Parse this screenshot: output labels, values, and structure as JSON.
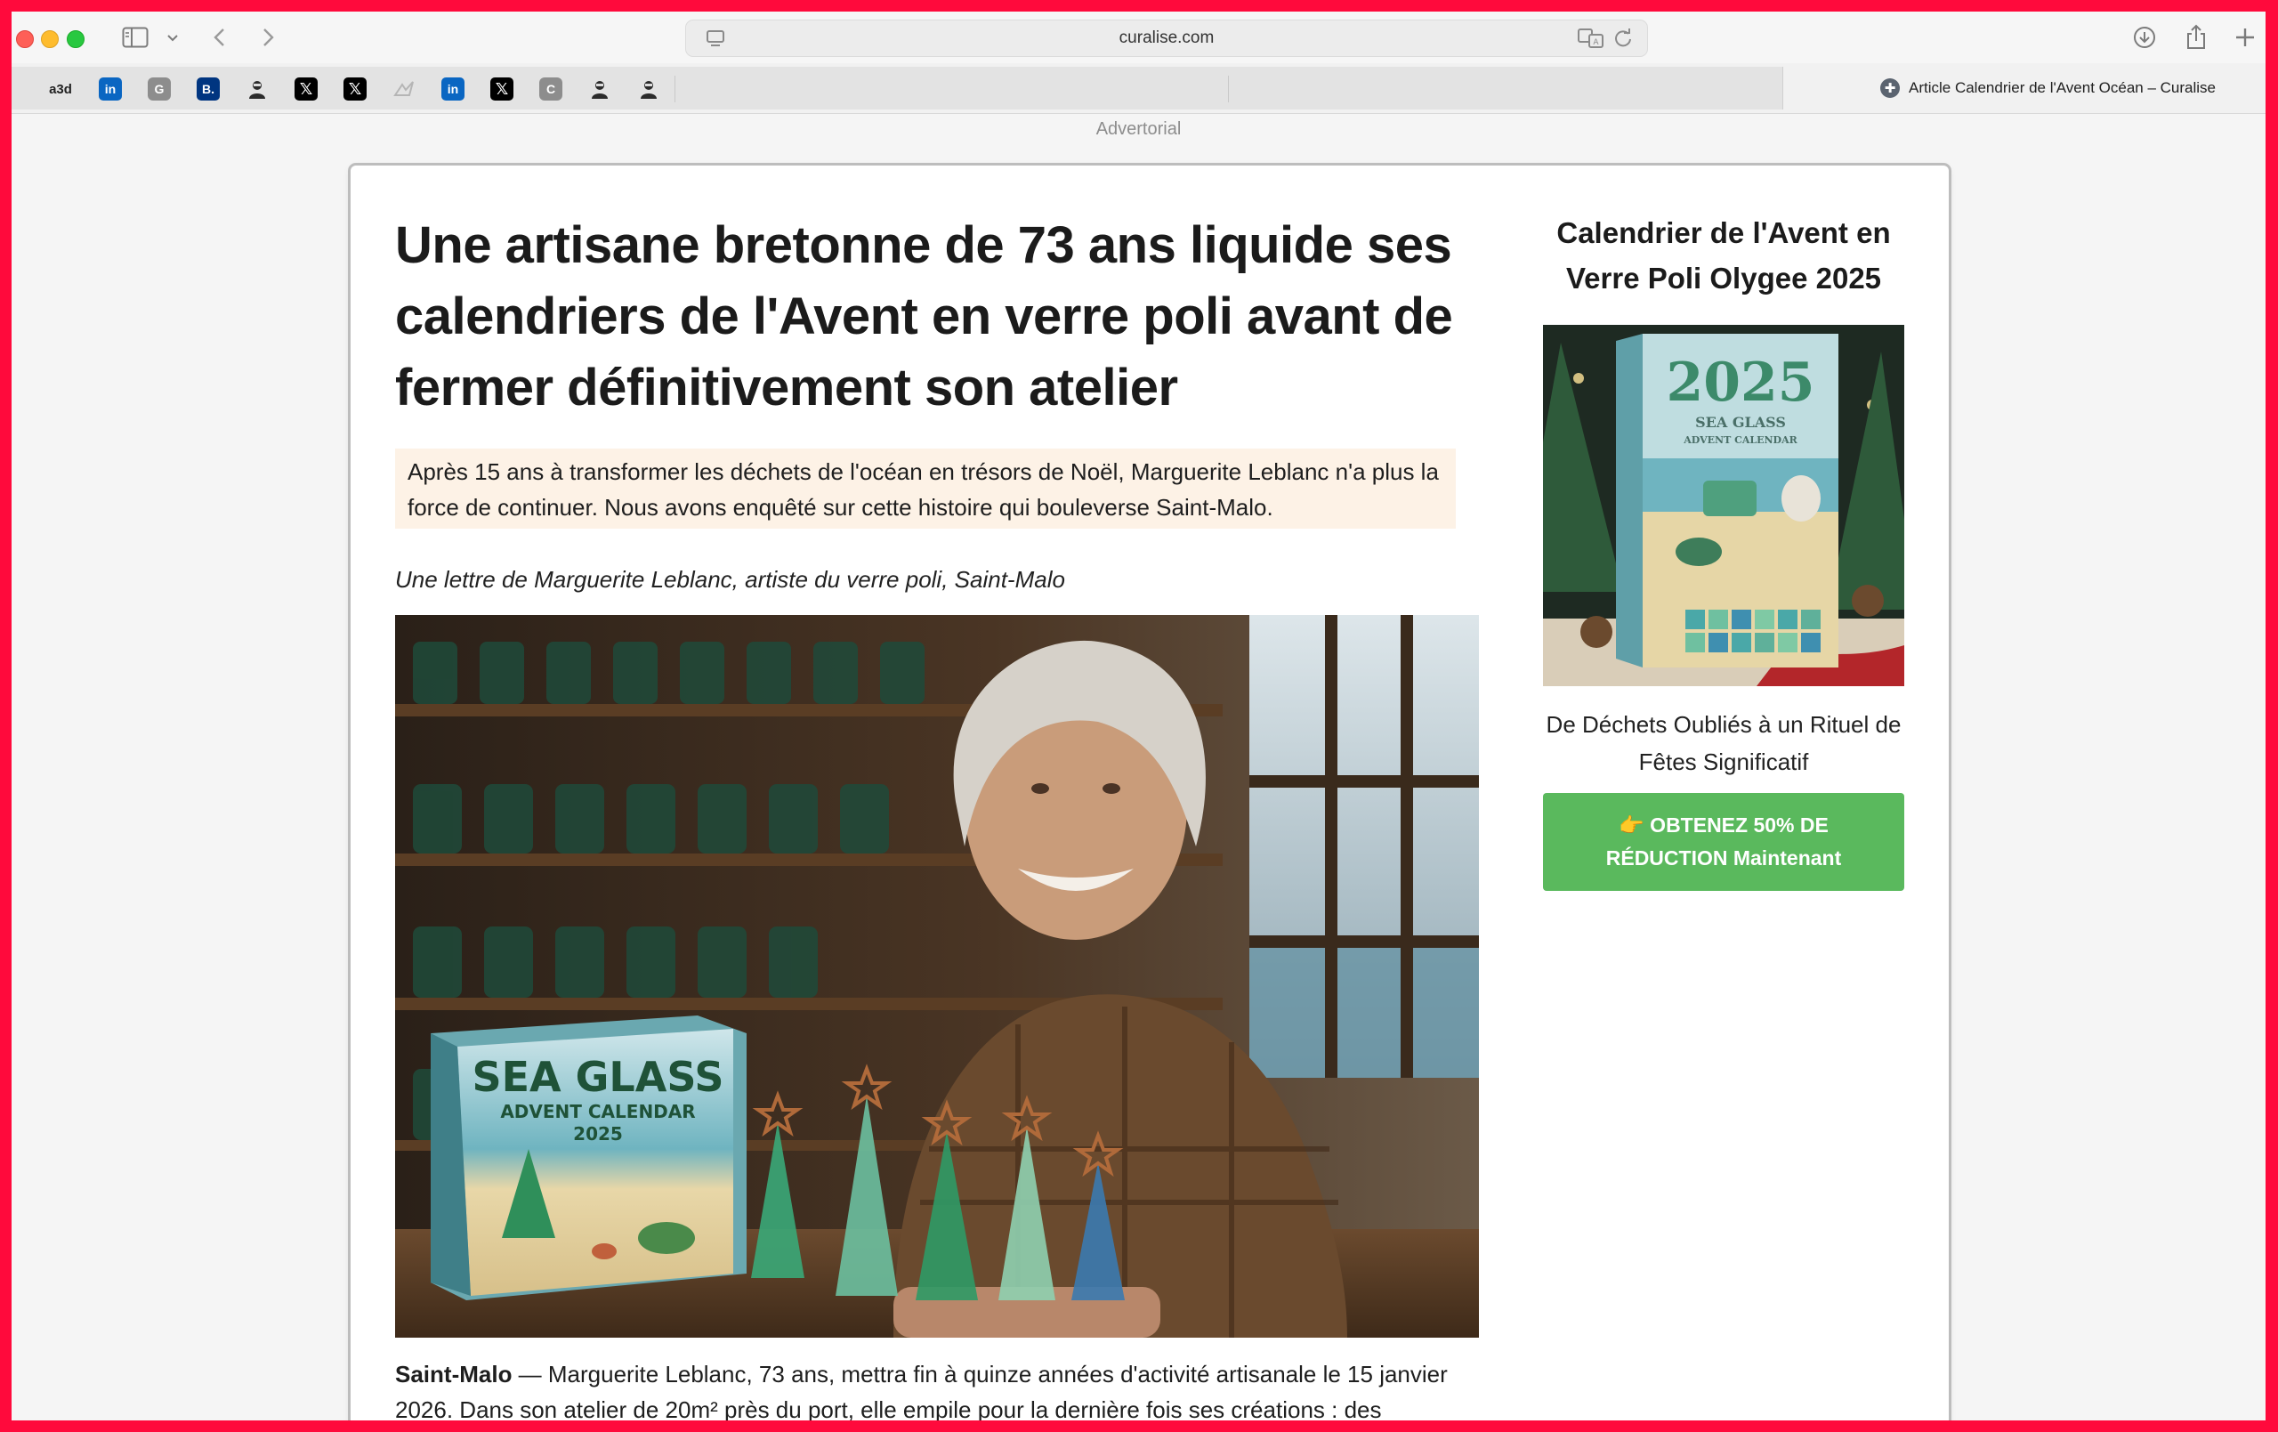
{
  "browser": {
    "url": "curalise.com",
    "active_tab_title": "Article Calendrier de l'Avent Océan – Curalise",
    "favorites": [
      {
        "icon": "partial-icon",
        "label": "",
        "kind": "edge"
      },
      {
        "icon": "a3d-icon",
        "label": "a3d",
        "kind": "a3"
      },
      {
        "icon": "linkedin-icon",
        "label": "in",
        "kind": "li"
      },
      {
        "icon": "g-icon",
        "label": "G",
        "kind": "g"
      },
      {
        "icon": "booking-icon",
        "label": "B.",
        "kind": "b"
      },
      {
        "icon": "person-icon",
        "label": "",
        "kind": "p"
      },
      {
        "icon": "x-icon",
        "label": "𝕏",
        "kind": "x"
      },
      {
        "icon": "x-icon",
        "label": "𝕏",
        "kind": "x"
      },
      {
        "icon": "bird-icon",
        "label": "",
        "kind": "bird"
      },
      {
        "icon": "linkedin-icon",
        "label": "in",
        "kind": "li"
      },
      {
        "icon": "x-icon",
        "label": "𝕏",
        "kind": "x"
      },
      {
        "icon": "c-icon",
        "label": "C",
        "kind": "g"
      },
      {
        "icon": "person-icon",
        "label": "",
        "kind": "p"
      },
      {
        "icon": "person-icon",
        "label": "",
        "kind": "p"
      }
    ]
  },
  "page": {
    "advertorial_label": "Advertorial",
    "headline": "Une artisane bretonne de 73 ans liquide ses calendriers de l'Avent en verre poli avant de fermer définitivement son atelier",
    "lede": "Après 15 ans à transformer les déchets de l'océan en trésors de Noël, Marguerite Leblanc n'a plus la force de continuer. Nous avons enquêté sur cette histoire qui bouleverse Saint-Malo.",
    "byline": "Une lettre de Marguerite Leblanc, artiste du verre poli, Saint-Malo",
    "hero_box_text": {
      "line1": "SEA GLASS",
      "line2": "ADVENT CALENDAR",
      "line3": "2025"
    },
    "body_lead": "Saint-Malo",
    "body_text": " — Marguerite Leblanc, 73 ans, mettra fin à quinze années d'activité artisanale le 15 janvier 2026. Dans son atelier de 20m² près du port, elle empile pour la dernière fois ses créations : des"
  },
  "sidebar": {
    "title": "Calendrier de l'Avent en Verre Poli Olygee 2025",
    "product_box_text": {
      "year": "2025",
      "line1": "SEA GLASS",
      "line2": "ADVENT CALENDAR"
    },
    "subtitle": "De Déchets Oubliés à un Rituel de Fêtes Significatif",
    "cta_label": "👉 OBTENEZ 50% DE RÉDUCTION Maintenant"
  }
}
